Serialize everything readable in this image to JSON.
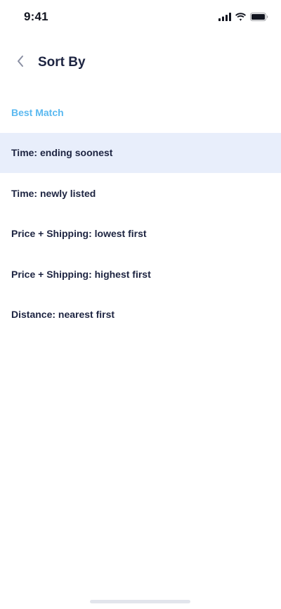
{
  "status_bar": {
    "time": "9:41",
    "icons": [
      "signal-icon",
      "wifi-icon",
      "battery-icon"
    ]
  },
  "header": {
    "back_icon": "chevron-left-icon",
    "title": "Sort By"
  },
  "sort_options": [
    {
      "label": "Best Match",
      "state": "selected"
    },
    {
      "label": "Time: ending soonest",
      "state": "highlighted"
    },
    {
      "label": "Time: newly listed",
      "state": "default"
    },
    {
      "label": "Price + Shipping: lowest first",
      "state": "default"
    },
    {
      "label": "Price + Shipping: highest first",
      "state": "default"
    },
    {
      "label": "Distance: nearest first",
      "state": "default"
    }
  ],
  "colors": {
    "accent": "#5bb9f0",
    "highlight_bg": "#e8eefb",
    "text_primary": "#1d2441"
  }
}
